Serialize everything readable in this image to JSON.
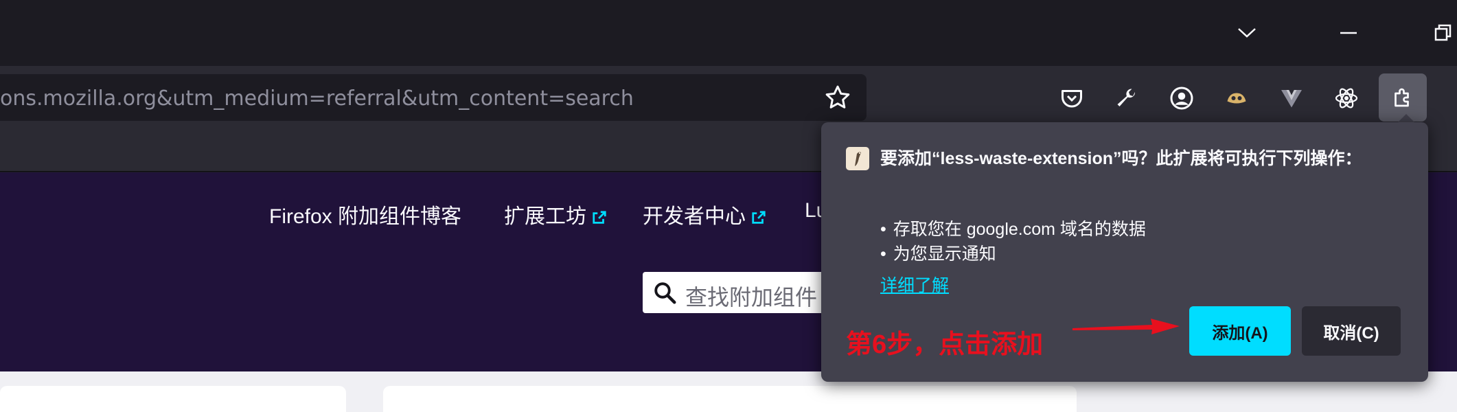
{
  "window": {
    "controls": [
      "chevron-down-icon",
      "minimize-icon",
      "restore-icon"
    ]
  },
  "toolbar": {
    "url": "ons.mozilla.org&utm_medium=referral&utm_content=search",
    "icons": [
      "bookmark-star-icon",
      "pocket-icon",
      "wrench-icon",
      "account-icon",
      "extension-a-icon",
      "extension-v-icon",
      "react-icon",
      "extensions-puzzle-icon"
    ]
  },
  "page": {
    "nav": {
      "blog": "Firefox 附加组件博客",
      "workshop": "扩展工坊",
      "dev_center": "开发者中心",
      "partial": "Lu"
    },
    "search": {
      "placeholder": "查找附加组件"
    }
  },
  "popup": {
    "title": "要添加“less-waste-extension”吗？此扩展将可执行下列操作：",
    "permissions": [
      "存取您在 google.com 域名的数据",
      "为您显示通知"
    ],
    "learn_more": "详细了解",
    "add_button": "添加(A)",
    "cancel_button": "取消(C)"
  },
  "annotation": {
    "text": "第6步，点击添加",
    "color": "#e8101e"
  },
  "colors": {
    "accent": "#00ddff",
    "page_header": "#20123a",
    "popup_bg": "#42414d"
  }
}
